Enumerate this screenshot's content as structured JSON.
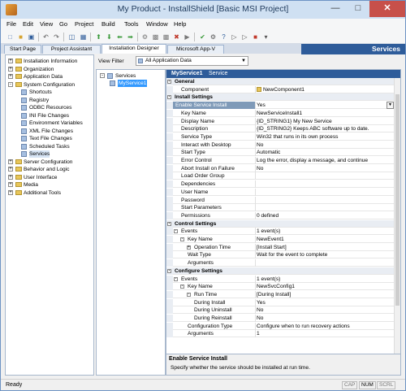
{
  "window": {
    "title": "My Product - InstallShield [Basic MSI Project]"
  },
  "menu": [
    "File",
    "Edit",
    "View",
    "Go",
    "Project",
    "Build",
    "Tools",
    "Window",
    "Help"
  ],
  "tabs": [
    "Start Page",
    "Project Assistant",
    "Installation Designer",
    "Microsoft App-V"
  ],
  "active_tab": "Installation Designer",
  "header_title": "Services",
  "nav": [
    {
      "label": "Installation Information",
      "level": 0,
      "expander": "+",
      "icon": "folder"
    },
    {
      "label": "Organization",
      "level": 0,
      "expander": "+",
      "icon": "folder"
    },
    {
      "label": "Application Data",
      "level": 0,
      "expander": "+",
      "icon": "folder"
    },
    {
      "label": "System Configuration",
      "level": 0,
      "expander": "-",
      "icon": "folder"
    },
    {
      "label": "Shortcuts",
      "level": 1,
      "icon": "leaf"
    },
    {
      "label": "Registry",
      "level": 1,
      "icon": "leaf"
    },
    {
      "label": "ODBC Resources",
      "level": 1,
      "icon": "leaf"
    },
    {
      "label": "INI File Changes",
      "level": 1,
      "icon": "leaf"
    },
    {
      "label": "Environment Variables",
      "level": 1,
      "icon": "leaf"
    },
    {
      "label": "XML File Changes",
      "level": 1,
      "icon": "leaf"
    },
    {
      "label": "Text File Changes",
      "level": 1,
      "icon": "leaf"
    },
    {
      "label": "Scheduled Tasks",
      "level": 1,
      "icon": "leaf"
    },
    {
      "label": "Services",
      "level": 1,
      "icon": "leaf",
      "selected": true
    },
    {
      "label": "Server Configuration",
      "level": 0,
      "expander": "+",
      "icon": "folder"
    },
    {
      "label": "Behavior and Logic",
      "level": 0,
      "expander": "+",
      "icon": "folder"
    },
    {
      "label": "User Interface",
      "level": 0,
      "expander": "+",
      "icon": "folder"
    },
    {
      "label": "Media",
      "level": 0,
      "expander": "+",
      "icon": "folder"
    },
    {
      "label": "Additional Tools",
      "level": 0,
      "expander": "+",
      "icon": "folder"
    }
  ],
  "view_filter": {
    "label": "View Filter",
    "value": "All Application Data"
  },
  "services_tree": {
    "root": "Services",
    "child": "MyService1"
  },
  "grid": {
    "name": "MyService1",
    "type": "Service",
    "rows": [
      {
        "kind": "cat",
        "name": "General",
        "exp": "-"
      },
      {
        "kind": "prop",
        "name": "Component",
        "value": "NewComponent1",
        "indent": 1,
        "icon": true
      },
      {
        "kind": "cat",
        "name": "Install Settings",
        "exp": "-"
      },
      {
        "kind": "prop",
        "name": "Enable Service Install",
        "value": "Yes",
        "indent": 1,
        "selected": true,
        "dropdown": true
      },
      {
        "kind": "prop",
        "name": "Key Name",
        "value": "NewServiceInstall1",
        "indent": 1
      },
      {
        "kind": "prop",
        "name": "Display Name",
        "value": "{ID_STRING1} My New Service",
        "indent": 1
      },
      {
        "kind": "prop",
        "name": "Description",
        "value": "{ID_STRING2} Keeps ABC software up to date.",
        "indent": 1
      },
      {
        "kind": "prop",
        "name": "Service Type",
        "value": "Win32 that runs in its own process",
        "indent": 1
      },
      {
        "kind": "prop",
        "name": "Interact with Desktop",
        "value": "No",
        "indent": 1
      },
      {
        "kind": "prop",
        "name": "Start Type",
        "value": "Automatic",
        "indent": 1
      },
      {
        "kind": "prop",
        "name": "Error Control",
        "value": "Log the error, display a message, and continue",
        "indent": 1
      },
      {
        "kind": "prop",
        "name": "Abort Install on Failure",
        "value": "No",
        "indent": 1
      },
      {
        "kind": "prop",
        "name": "Load Order Group",
        "value": "",
        "indent": 1
      },
      {
        "kind": "prop",
        "name": "Dependencies",
        "value": "",
        "indent": 1
      },
      {
        "kind": "prop",
        "name": "User Name",
        "value": "",
        "indent": 1
      },
      {
        "kind": "prop",
        "name": "Password",
        "value": "",
        "indent": 1
      },
      {
        "kind": "prop",
        "name": "Start Parameters",
        "value": "",
        "indent": 1
      },
      {
        "kind": "prop",
        "name": "Permissions",
        "value": "0 defined",
        "indent": 1
      },
      {
        "kind": "cat",
        "name": "Control Settings",
        "exp": "-"
      },
      {
        "kind": "prop",
        "name": "Events",
        "value": "1 event(s)",
        "indent": 0,
        "exp": "-"
      },
      {
        "kind": "prop",
        "name": "Key Name",
        "value": "NewEvent1",
        "indent": 1,
        "exp": "-"
      },
      {
        "kind": "prop",
        "name": "Operation Time",
        "value": "[Install Start]",
        "indent": 2,
        "exp": "+"
      },
      {
        "kind": "prop",
        "name": "Wait Type",
        "value": "Wait for the event to complete",
        "indent": 2
      },
      {
        "kind": "prop",
        "name": "Arguments",
        "value": "",
        "indent": 2
      },
      {
        "kind": "cat",
        "name": "Configure Settings",
        "exp": "-"
      },
      {
        "kind": "prop",
        "name": "Events",
        "value": "1 event(s)",
        "indent": 0,
        "exp": "-"
      },
      {
        "kind": "prop",
        "name": "Key Name",
        "value": "NewSvcConfig1",
        "indent": 1,
        "exp": "-"
      },
      {
        "kind": "prop",
        "name": "Run Time",
        "value": "[During Install]",
        "indent": 2,
        "exp": "-"
      },
      {
        "kind": "prop",
        "name": "During Install",
        "value": "Yes",
        "indent": 3
      },
      {
        "kind": "prop",
        "name": "During Uninstall",
        "value": "No",
        "indent": 3
      },
      {
        "kind": "prop",
        "name": "During Reinstall",
        "value": "No",
        "indent": 3
      },
      {
        "kind": "prop",
        "name": "Configuration Type",
        "value": "Configure when to run recovery actions",
        "indent": 2
      },
      {
        "kind": "prop",
        "name": "Arguments",
        "value": "1",
        "indent": 2
      }
    ]
  },
  "help": {
    "title": "Enable Service Install",
    "desc": "Specify whether the service should be installed at run time."
  },
  "status": {
    "text": "Ready",
    "indicators": [
      {
        "label": "CAP",
        "on": false
      },
      {
        "label": "NUM",
        "on": true
      },
      {
        "label": "SCRL",
        "on": false
      }
    ]
  }
}
